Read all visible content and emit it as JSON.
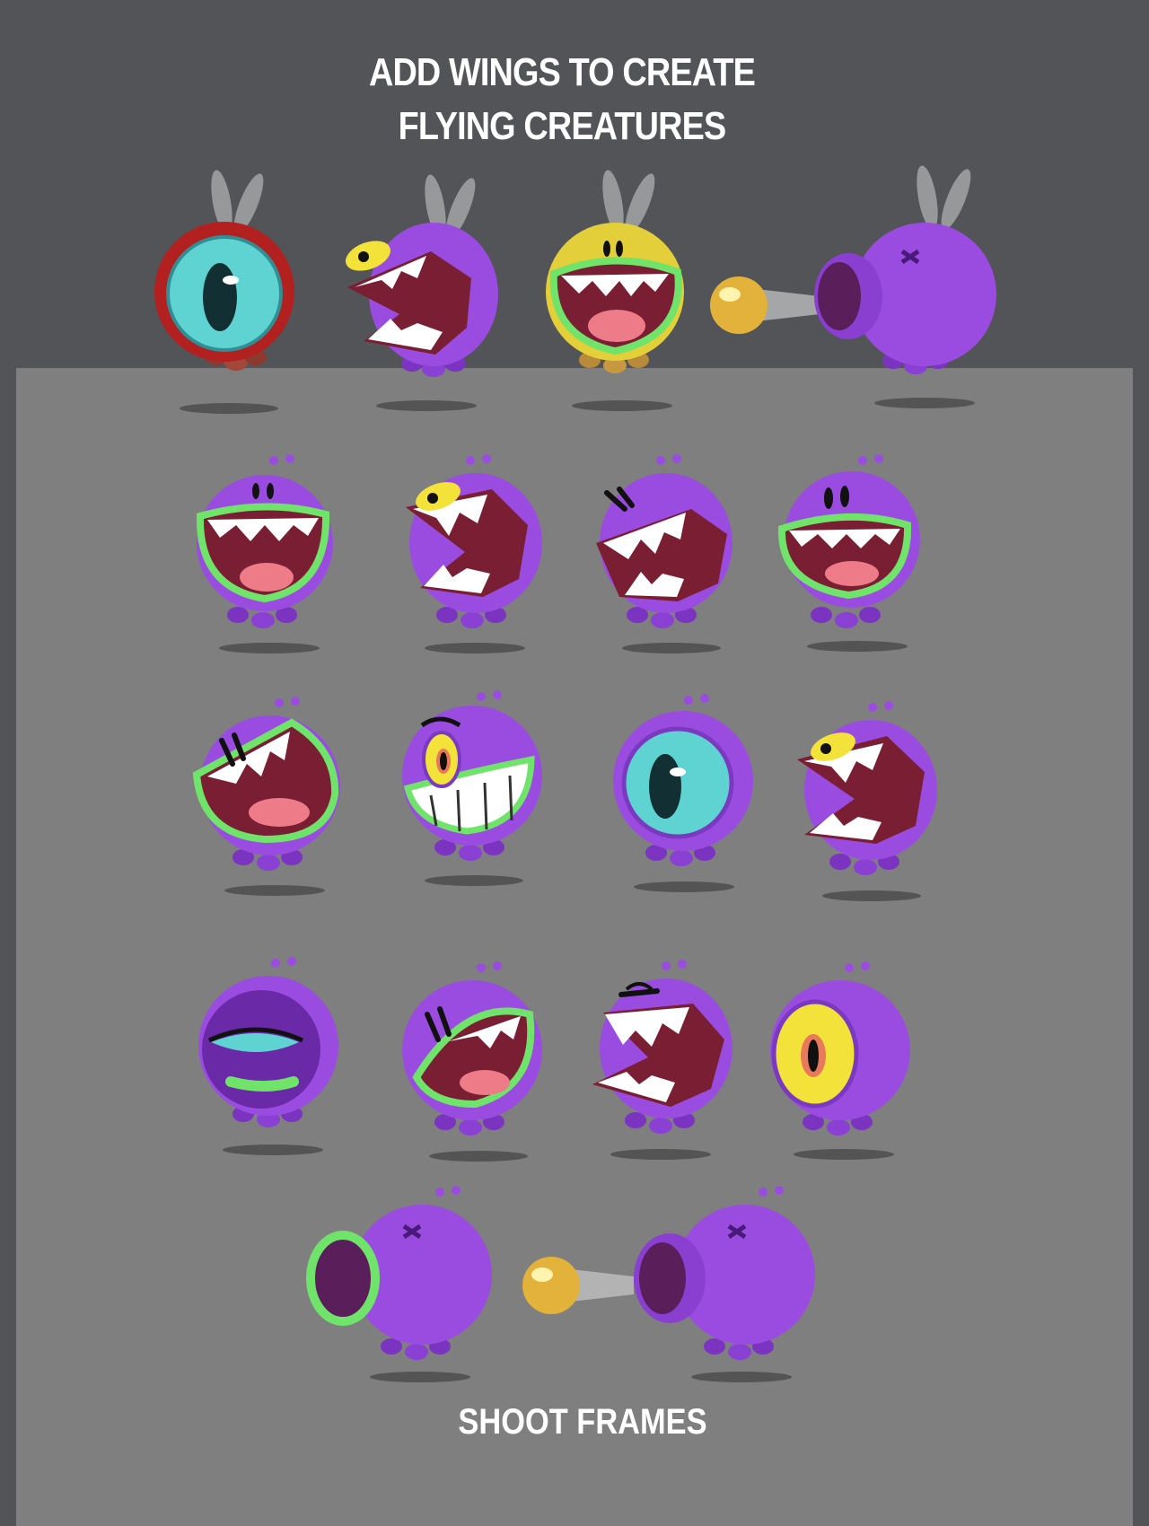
{
  "header": {
    "title_line1": "ADD WINGS TO CREATE",
    "title_line2": "FLYING CREATURES"
  },
  "footer": {
    "caption": "SHOOT FRAMES"
  },
  "colors": {
    "top_background": "#535457",
    "panel_background": "#7f7f80",
    "creature_purple": "#9a4ce0",
    "mouth_red": "#7a1f33",
    "outline_green": "#6fe36a",
    "eye_teal": "#5fd2d2",
    "eye_yellow": "#f2e23a",
    "projectile_gold": "#e3b23a"
  },
  "rows": [
    {
      "name": "flying",
      "creatures": [
        "one-eyed-red-flyer",
        "chomper-flyer",
        "yellow-grinner-flyer",
        "shooter-flyer"
      ]
    },
    {
      "name": "row-2",
      "creatures": [
        "green-grinner",
        "chomper-side",
        "chomper-left",
        "green-grinner-alt"
      ]
    },
    {
      "name": "row-3",
      "creatures": [
        "green-chomper",
        "yellow-eye-grinner",
        "teal-cyclops",
        "yellow-eye-chomper"
      ]
    },
    {
      "name": "row-4",
      "creatures": [
        "sleepy-cyclops",
        "green-smirker",
        "chomper-open",
        "yellow-cyclops"
      ]
    },
    {
      "name": "shoot",
      "creatures": [
        "shooter-green-ring",
        "shooter-firing"
      ]
    }
  ]
}
